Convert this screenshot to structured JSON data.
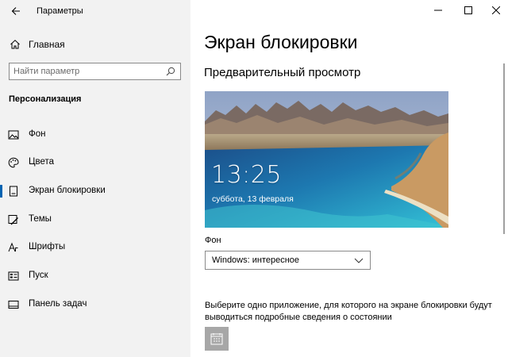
{
  "window": {
    "title": "Параметры",
    "controls": {
      "minimize": "—",
      "maximize": "☐",
      "close": "✕"
    }
  },
  "sidebar": {
    "home_label": "Главная",
    "search_placeholder": "Найти параметр",
    "section_heading": "Персонализация",
    "items": [
      {
        "label": "Фон",
        "icon": "picture-icon",
        "active": false
      },
      {
        "label": "Цвета",
        "icon": "palette-icon",
        "active": false
      },
      {
        "label": "Экран блокировки",
        "icon": "lock-screen-icon",
        "active": true
      },
      {
        "label": "Темы",
        "icon": "brush-icon",
        "active": false
      },
      {
        "label": "Шрифты",
        "icon": "font-icon",
        "active": false
      },
      {
        "label": "Пуск",
        "icon": "start-icon",
        "active": false
      },
      {
        "label": "Панель задач",
        "icon": "taskbar-icon",
        "active": false
      }
    ]
  },
  "main": {
    "title": "Экран блокировки",
    "preview_heading": "Предварительный просмотр",
    "preview": {
      "time": "13:25",
      "date": "суббота, 13 февраля"
    },
    "background_label": "Фон",
    "background_value": "Windows: интересное",
    "detailed_status_text": "Выберите одно приложение, для которого на экране блокировки будут выводиться подробные сведения о состоянии",
    "detailed_status_app_icon": "calendar-icon"
  },
  "colors": {
    "accent": "#0063b1",
    "sidebar_bg": "#f2f2f2"
  }
}
